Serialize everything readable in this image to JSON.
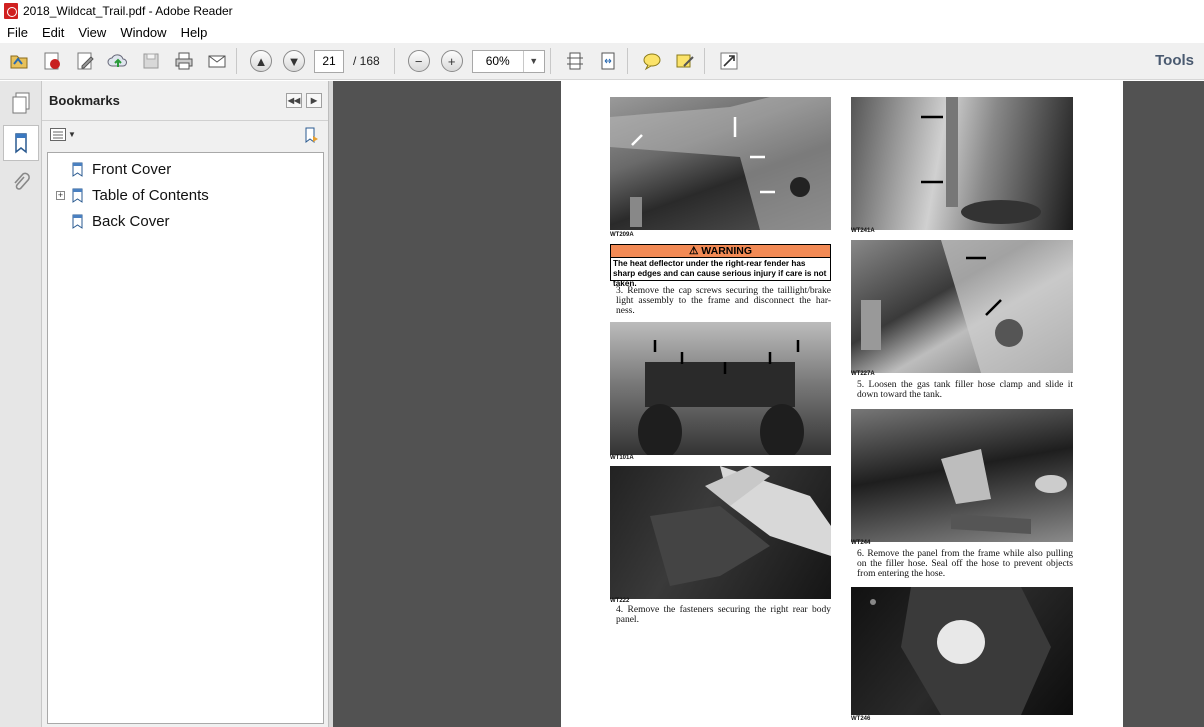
{
  "window": {
    "title": "2018_Wildcat_Trail.pdf - Adobe Reader"
  },
  "menu": [
    "File",
    "Edit",
    "View",
    "Window",
    "Help"
  ],
  "toolbar": {
    "page_current": "21",
    "page_total": "/ 168",
    "zoom": "60%",
    "tools_label": "Tools"
  },
  "bookmarks": {
    "title": "Bookmarks",
    "items": [
      {
        "label": "Front Cover",
        "expandable": false
      },
      {
        "label": "Table of Contents",
        "expandable": true
      },
      {
        "label": "Back Cover",
        "expandable": false
      }
    ]
  },
  "page": {
    "captions": {
      "p1": "WT209A",
      "p2": "WT101A",
      "p3": "WT222",
      "p4": "WT241A",
      "p5": "WT227A",
      "p6": "WT244",
      "p7": "WT246"
    },
    "warning": {
      "header": "WARNING",
      "text": "The heat deflector under the right-rear fender has sharp edges and can cause serious injury if care is not taken."
    },
    "steps": {
      "s3": "3. Remove the cap screws securing the taillight/brake light assembly to the frame and disconnect the har- ness.",
      "s4": "4. Remove the fasteners securing the right rear body panel.",
      "s5": "5. Loosen the gas tank filler hose clamp and slide it down toward the tank.",
      "s6": "6. Remove the panel from the frame while also pulling on the filler hose. Seal off the hose to prevent objects from entering the hose."
    }
  }
}
